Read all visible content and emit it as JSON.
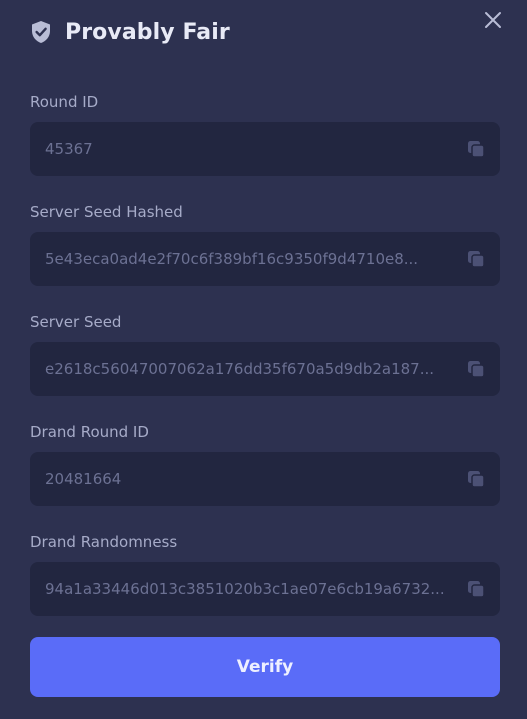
{
  "header": {
    "title": "Provably Fair",
    "icon": "shield-check-icon"
  },
  "close_icon": "close-icon",
  "fields": [
    {
      "label": "Round ID",
      "value": "45367"
    },
    {
      "label": "Server Seed Hashed",
      "value": "5e43eca0ad4e2f70c6f389bf16c9350f9d4710e8..."
    },
    {
      "label": "Server Seed",
      "value": "e2618c56047007062a176dd35f670a5d9db2a187..."
    },
    {
      "label": "Drand Round ID",
      "value": "20481664"
    },
    {
      "label": "Drand Randomness",
      "value": "94a1a33446d013c3851020b3c1ae07e6cb19a6732..."
    }
  ],
  "copy_icon": "copy-icon",
  "verify_label": "Verify",
  "colors": {
    "background": "#2d3150",
    "field_background": "#222640",
    "accent": "#5a6cf8",
    "label": "#a6abc8",
    "value": "#6c7193"
  }
}
